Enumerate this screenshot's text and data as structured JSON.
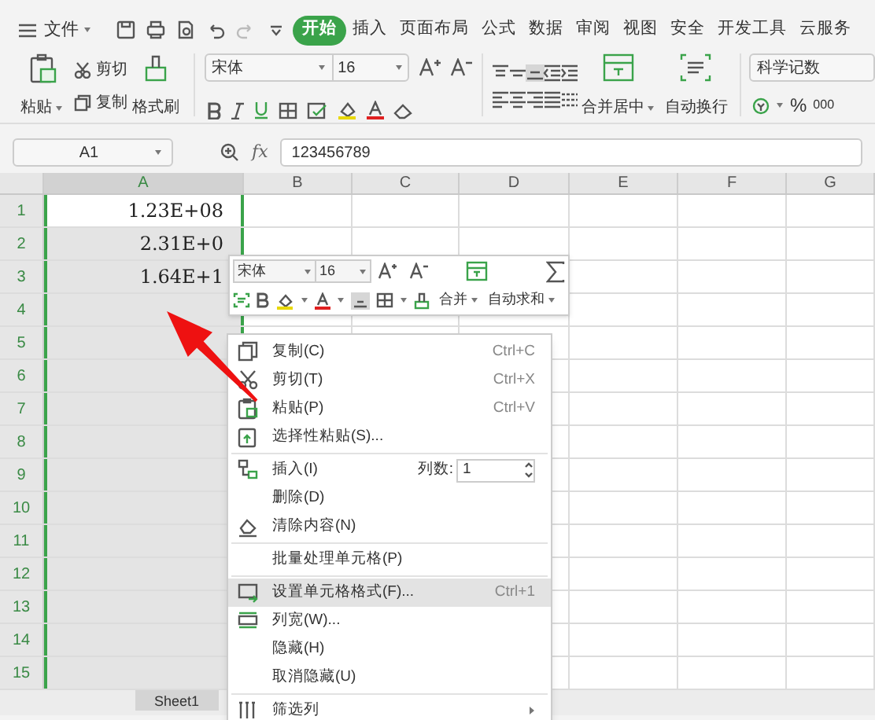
{
  "menu_bar": {
    "file_label": "文件",
    "tabs": [
      {
        "label": "开始",
        "selected": true
      },
      {
        "label": "插入",
        "selected": false
      },
      {
        "label": "页面布局",
        "selected": false
      },
      {
        "label": "公式",
        "selected": false
      },
      {
        "label": "数据",
        "selected": false
      },
      {
        "label": "审阅",
        "selected": false
      },
      {
        "label": "视图",
        "selected": false
      },
      {
        "label": "安全",
        "selected": false
      },
      {
        "label": "开发工具",
        "selected": false
      },
      {
        "label": "云服务",
        "selected": false
      }
    ]
  },
  "ribbon": {
    "paste": "粘贴",
    "cut": "剪切",
    "copy": "复制",
    "format_painter": "格式刷",
    "font": "宋体",
    "font_size": "16",
    "merge": "合并居中",
    "wrap": "自动换行",
    "number_format": "科学记数",
    "percent": "%",
    "thousands": "000"
  },
  "formula_bar": {
    "cell_ref": "A1",
    "fx": "fx",
    "value": "123456789"
  },
  "sheet": {
    "columns": [
      {
        "label": "A",
        "selected": true
      },
      {
        "label": "B",
        "selected": false
      },
      {
        "label": "C",
        "selected": false
      },
      {
        "label": "D",
        "selected": false
      },
      {
        "label": "E",
        "selected": false
      },
      {
        "label": "F",
        "selected": false
      },
      {
        "label": "G",
        "selected": false
      }
    ],
    "rows": [
      {
        "label": "1",
        "selected": true,
        "active": true,
        "value": "1.23E+08"
      },
      {
        "label": "2",
        "selected": true,
        "active": false,
        "value": "2.31E+0"
      },
      {
        "label": "3",
        "selected": true,
        "active": false,
        "value": "1.64E+1"
      },
      {
        "label": "4",
        "selected": true,
        "active": false
      },
      {
        "label": "5",
        "selected": true,
        "active": false
      },
      {
        "label": "6",
        "selected": true,
        "active": false
      },
      {
        "label": "7",
        "selected": true,
        "active": false
      },
      {
        "label": "8",
        "selected": true,
        "active": false
      },
      {
        "label": "9",
        "selected": true,
        "active": false
      },
      {
        "label": "10",
        "selected": true,
        "active": false
      },
      {
        "label": "11",
        "selected": true,
        "active": false
      },
      {
        "label": "12",
        "selected": true,
        "active": false
      },
      {
        "label": "13",
        "selected": true,
        "active": false
      },
      {
        "label": "14",
        "selected": true,
        "active": false
      },
      {
        "label": "15",
        "selected": true,
        "active": false
      }
    ]
  },
  "mini_toolbar": {
    "font": "宋体",
    "font_size": "16",
    "merge": "合并",
    "autosum": "自动求和"
  },
  "context_menu": {
    "items": [
      {
        "kind": "item",
        "label": "复制(C)",
        "shortcut": "Ctrl+C",
        "selected": false
      },
      {
        "kind": "item",
        "label": "剪切(T)",
        "shortcut": "Ctrl+X",
        "selected": false
      },
      {
        "kind": "item",
        "label": "粘贴(P)",
        "shortcut": "Ctrl+V",
        "selected": false
      },
      {
        "kind": "item",
        "label": "选择性粘贴(S)...",
        "selected": false
      },
      {
        "kind": "divider"
      },
      {
        "kind": "spinner",
        "label": "插入(I)",
        "field_label": "列数:",
        "value": "1",
        "selected": false
      },
      {
        "kind": "item",
        "label": "删除(D)",
        "selected": false
      },
      {
        "kind": "item",
        "label": "清除内容(N)",
        "selected": false
      },
      {
        "kind": "divider"
      },
      {
        "kind": "item",
        "label": "批量处理单元格(P)",
        "selected": false
      },
      {
        "kind": "divider"
      },
      {
        "kind": "item",
        "label": "设置单元格格式(F)...",
        "shortcut": "Ctrl+1",
        "selected": true
      },
      {
        "kind": "item",
        "label": "列宽(W)...",
        "selected": false
      },
      {
        "kind": "item",
        "label": "隐藏(H)",
        "selected": false
      },
      {
        "kind": "item",
        "label": "取消隐藏(U)",
        "selected": false
      },
      {
        "kind": "divider"
      },
      {
        "kind": "submenu",
        "label": "筛选列",
        "selected": false
      }
    ]
  },
  "sheet_tabs": [
    {
      "label": "Sheet1",
      "selected": true
    }
  ]
}
